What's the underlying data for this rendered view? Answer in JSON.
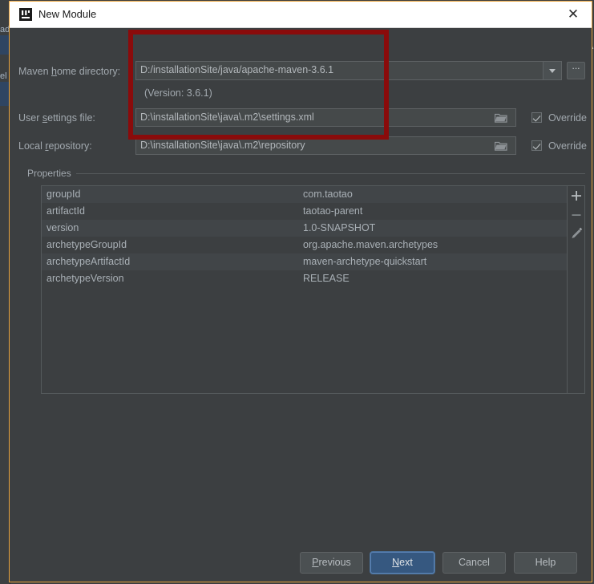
{
  "backdrop": {
    "left_fragments": [
      "ad",
      "el"
    ]
  },
  "window": {
    "title": "New Module",
    "icon": "intellij-idea-icon",
    "close_label": "✕",
    "border_color": "#e8a33d"
  },
  "form": {
    "maven_home": {
      "label_prefix": "Maven ",
      "label_mnemonic": "h",
      "label_suffix": "ome directory:",
      "value": "D:/installationSite/java/apache-maven-3.6.1",
      "dropdown_icon": "chevron-down-icon",
      "browse_label": "..."
    },
    "version_note": "(Version: 3.6.1)",
    "user_settings": {
      "label_prefix": "User ",
      "label_mnemonic": "s",
      "label_suffix": "ettings file:",
      "value": "D:\\installationSite\\java\\.m2\\settings.xml",
      "folder_icon": "folder-icon",
      "override_label": "Override",
      "override_checked": true
    },
    "local_repository": {
      "label_prefix": "Local ",
      "label_mnemonic": "r",
      "label_suffix": "epository:",
      "value": "D:\\installationSite\\java\\.m2\\repository",
      "folder_icon": "folder-icon",
      "override_label": "Override",
      "override_checked": true
    }
  },
  "properties": {
    "group_label": "Properties",
    "rows": [
      {
        "key": "groupId",
        "value": "com.taotao"
      },
      {
        "key": "artifactId",
        "value": "taotao-parent"
      },
      {
        "key": "version",
        "value": "1.0-SNAPSHOT"
      },
      {
        "key": "archetypeGroupId",
        "value": "org.apache.maven.archetypes"
      },
      {
        "key": "archetypeArtifactId",
        "value": "maven-archetype-quickstart"
      },
      {
        "key": "archetypeVersion",
        "value": "RELEASE"
      }
    ],
    "toolbar": {
      "add_icon": "plus-icon",
      "remove_icon": "minus-icon",
      "edit_icon": "pencil-icon"
    }
  },
  "footer": {
    "previous": {
      "prefix": "",
      "mnemonic": "P",
      "suffix": "revious"
    },
    "next": {
      "prefix": "",
      "mnemonic": "N",
      "suffix": "ext",
      "primary": true,
      "color": "#365880"
    },
    "cancel": "Cancel",
    "help": "Help"
  },
  "annotation": {
    "highlight_color": "#8a0b0b",
    "shape": "rectangle"
  }
}
